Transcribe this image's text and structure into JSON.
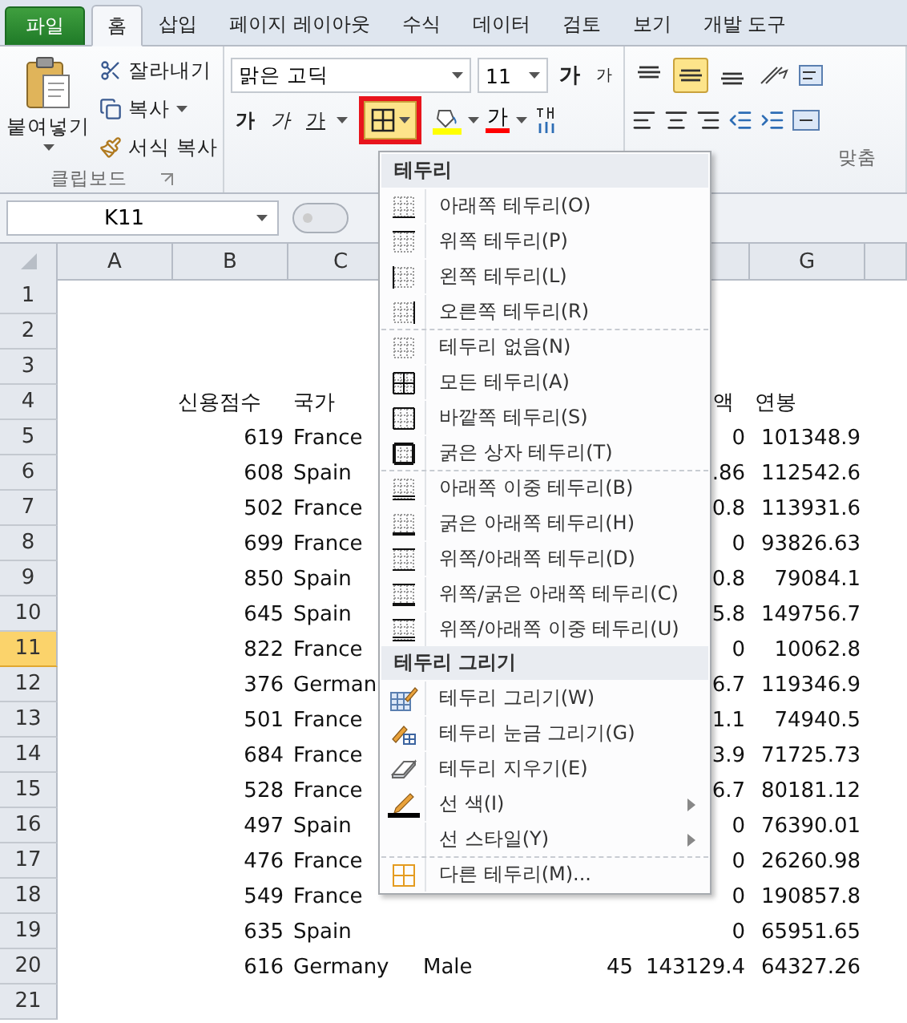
{
  "tabs": [
    {
      "label": "파일",
      "kind": "file",
      "selected": false
    },
    {
      "label": "홈",
      "kind": "tab",
      "selected": true
    },
    {
      "label": "삽입",
      "kind": "tab",
      "selected": false
    },
    {
      "label": "페이지 레이아웃",
      "kind": "tab",
      "selected": false
    },
    {
      "label": "수식",
      "kind": "tab",
      "selected": false
    },
    {
      "label": "데이터",
      "kind": "tab",
      "selected": false
    },
    {
      "label": "검토",
      "kind": "tab",
      "selected": false
    },
    {
      "label": "보기",
      "kind": "tab",
      "selected": false
    },
    {
      "label": "개발 도구",
      "kind": "tab",
      "selected": false
    }
  ],
  "clipboard": {
    "paste": "붙여넣기",
    "cut": "잘라내기",
    "copy": "복사",
    "format_painter": "서식 복사",
    "label": "클립보드"
  },
  "font": {
    "name": "맑은 고딕",
    "size": "11",
    "grow": "가",
    "shrink": "가",
    "bold": "가",
    "italic": "가",
    "underline": "가",
    "font_color": "가",
    "borders_open": true
  },
  "alignment": {
    "label": "맞춤",
    "vertical": [
      {
        "kind": "top",
        "selected": false
      },
      {
        "kind": "middle",
        "selected": true
      },
      {
        "kind": "bottom",
        "selected": false
      }
    ]
  },
  "name_box": "K11",
  "columns": {
    "left": [
      "A",
      "B",
      "C"
    ],
    "right": [
      "G"
    ]
  },
  "rows": [
    {
      "number": "1",
      "selected": false
    },
    {
      "number": "2",
      "selected": false
    },
    {
      "number": "3",
      "selected": false
    },
    {
      "number": "4",
      "selected": false,
      "b": "신용점수",
      "c": "국가",
      "f": "액",
      "g": "연봉",
      "header": true
    },
    {
      "number": "5",
      "selected": false,
      "b": "619",
      "c": "France",
      "f": "0",
      "g": "101348.9"
    },
    {
      "number": "6",
      "selected": false,
      "b": "608",
      "c": "Spain",
      "f": ".86",
      "g": "112542.6"
    },
    {
      "number": "7",
      "selected": false,
      "b": "502",
      "c": "France",
      "f": "0.8",
      "g": "113931.6"
    },
    {
      "number": "8",
      "selected": false,
      "b": "699",
      "c": "France",
      "f": "0",
      "g": "93826.63"
    },
    {
      "number": "9",
      "selected": false,
      "b": "850",
      "c": "Spain",
      "f": "0.8",
      "g": "79084.1"
    },
    {
      "number": "10",
      "selected": false,
      "b": "645",
      "c": "Spain",
      "f": "5.8",
      "g": "149756.7"
    },
    {
      "number": "11",
      "selected": true,
      "b": "822",
      "c": "France",
      "f": "0",
      "g": "10062.8"
    },
    {
      "number": "12",
      "selected": false,
      "b": "376",
      "c": "German",
      "f": "6.7",
      "g": "119346.9"
    },
    {
      "number": "13",
      "selected": false,
      "b": "501",
      "c": "France",
      "f": "1.1",
      "g": "74940.5"
    },
    {
      "number": "14",
      "selected": false,
      "b": "684",
      "c": "France",
      "f": "3.9",
      "g": "71725.73"
    },
    {
      "number": "15",
      "selected": false,
      "b": "528",
      "c": "France",
      "f": "6.7",
      "g": "80181.12"
    },
    {
      "number": "16",
      "selected": false,
      "b": "497",
      "c": "Spain",
      "f": "0",
      "g": "76390.01"
    },
    {
      "number": "17",
      "selected": false,
      "b": "476",
      "c": "France",
      "f": "0",
      "g": "26260.98"
    },
    {
      "number": "18",
      "selected": false,
      "b": "549",
      "c": "France",
      "f": "0",
      "g": "190857.8"
    },
    {
      "number": "19",
      "selected": false,
      "b": "635",
      "c": "Spain",
      "f": "0",
      "g": "65951.65"
    },
    {
      "number": "20",
      "selected": false,
      "b": "616",
      "c": "Germany",
      "d": "Male",
      "e": "45",
      "f": "143129.4",
      "g": "64327.26"
    },
    {
      "number": "21",
      "selected": false
    }
  ],
  "menu": [
    {
      "title": "테두리",
      "items": [
        {
          "label": "아래쪽 테두리(O)",
          "kind": "bottom"
        },
        {
          "label": "위쪽 테두리(P)",
          "kind": "top"
        },
        {
          "label": "왼쪽 테두리(L)",
          "kind": "left"
        },
        {
          "label": "오른쪽 테두리(R)",
          "kind": "right"
        },
        {
          "label": "테두리 없음(N)",
          "kind": "none",
          "separator_before": true
        },
        {
          "label": "모든 테두리(A)",
          "kind": "all"
        },
        {
          "label": "바깥쪽 테두리(S)",
          "kind": "outside"
        },
        {
          "label": "굵은 상자 테두리(T)",
          "kind": "thickbox"
        },
        {
          "label": "아래쪽 이중 테두리(B)",
          "kind": "doublebottom",
          "separator_before": true
        },
        {
          "label": "굵은 아래쪽 테두리(H)",
          "kind": "thickbottom"
        },
        {
          "label": "위쪽/아래쪽 테두리(D)",
          "kind": "topbottom"
        },
        {
          "label": "위쪽/굵은 아래쪽 테두리(C)",
          "kind": "topthickbottom"
        },
        {
          "label": "위쪽/아래쪽 이중 테두리(U)",
          "kind": "topdoublebottom"
        }
      ]
    },
    {
      "title": "테두리 그리기",
      "items": [
        {
          "label": "테두리 그리기(W)",
          "kind": "draw"
        },
        {
          "label": "테두리 눈금 그리기(G)",
          "kind": "drawgrid"
        },
        {
          "label": "테두리 지우기(E)",
          "kind": "erase"
        },
        {
          "label": "선 색(I)",
          "kind": "linecolor",
          "submenu": true
        },
        {
          "label": "선 스타일(Y)",
          "kind": "blank",
          "submenu": true
        },
        {
          "label": "다른 테두리(M)...",
          "kind": "more",
          "separator_before": true
        }
      ]
    }
  ]
}
